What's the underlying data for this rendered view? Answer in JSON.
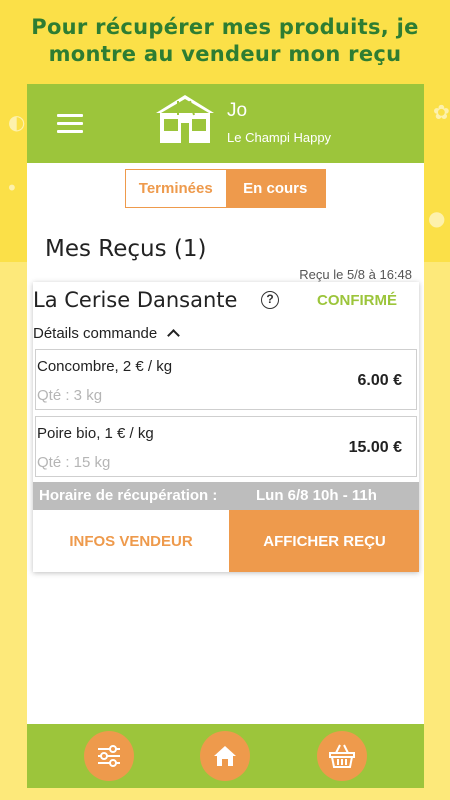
{
  "promo": {
    "line1": "Pour récupérer mes produits, je",
    "line2": "montre au vendeur mon reçu"
  },
  "header": {
    "user_name": "Jo",
    "shop_name": "Le Champi Happy"
  },
  "tabs": {
    "done_label": "Terminées",
    "current_label": "En cours",
    "active": "En cours"
  },
  "page": {
    "title": "Mes Reçus (1)"
  },
  "receipt": {
    "received_at": "Reçu le 5/8 à 16:48",
    "seller": "La Cerise Dansante",
    "status": "CONFIRMÉ",
    "details_label": "Détails commande",
    "items": [
      {
        "name": "Concombre, 2 € / kg",
        "qty": "Qté : 3 kg",
        "price": "6.00 €"
      },
      {
        "name": "Poire bio, 1 € / kg",
        "qty": "Qté : 15 kg",
        "price": "15.00 €"
      }
    ],
    "pickup_label": "Horaire de récupération :",
    "pickup_value": "Lun 6/8 10h - 11h",
    "seller_info_button": "INFOS VENDEUR",
    "show_receipt_button": "AFFICHER REÇU"
  },
  "bottom_nav": {
    "icons": [
      "filters-icon",
      "home-icon",
      "basket-icon"
    ]
  },
  "colors": {
    "green": "#9cc53b",
    "orange": "#ee9a4c",
    "yellow": "#fbe048",
    "promo_text": "#2e7d32",
    "gray_bar": "#bdbdbd"
  }
}
